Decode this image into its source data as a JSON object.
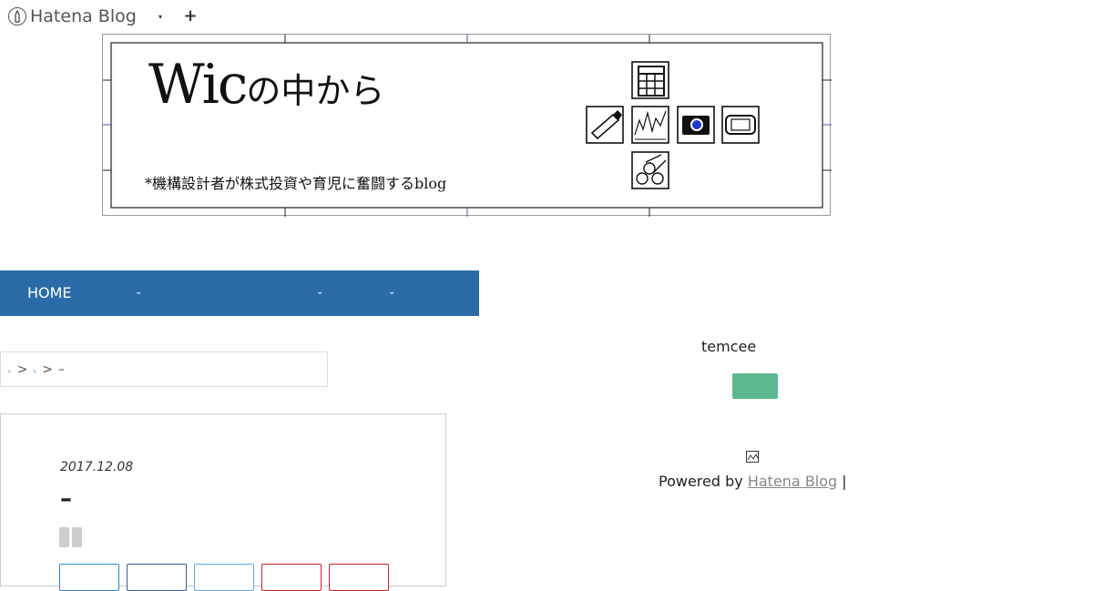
{
  "topbar": {
    "brand": "Hatena Blog",
    "menu_caret": "▾",
    "add": "+"
  },
  "banner": {
    "title_latin": "Wic",
    "title_jp": "の中から",
    "subtitle": "*機構設計者が株式投資や育児に奮闘するblog",
    "icons": [
      "calendar-icon",
      "baby-bottle-icon",
      "stock-chart-icon",
      "camera-icon",
      "game-console-icon",
      "wood-logs-icon"
    ]
  },
  "nav": {
    "home": "HOME",
    "chevrons": [
      "⌄",
      "⌄",
      "⌄"
    ]
  },
  "breadcrumb": {
    "sep1": ">",
    "sep2": ">",
    "current": "–"
  },
  "article": {
    "date": "2017.12.08",
    "title": "–"
  },
  "sidebar": {
    "author": "temcee",
    "powered_by": "Powered by",
    "powered_link": "Hatena Blog",
    "divider": "|"
  },
  "colors": {
    "nav_bg": "#2a6ba8",
    "follow_button": "#5cb88f",
    "link": "#2a8ad4"
  }
}
